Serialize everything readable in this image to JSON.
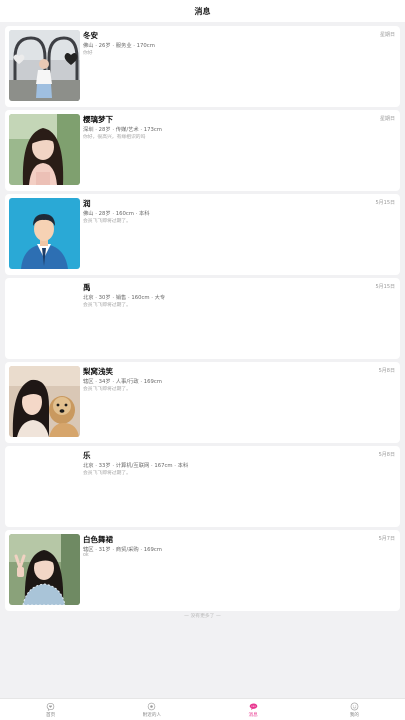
{
  "header": {
    "title": "消息"
  },
  "conversations": [
    {
      "name": "冬安",
      "date": "星期日",
      "info": "佛山 · 26岁 · 服务业 · 170cm",
      "message": "你好"
    },
    {
      "name": "樱璃梦下",
      "date": "星期日",
      "info": "深圳 · 28岁 · 传媒/艺术 · 173cm",
      "message": "你好，很高兴，有缘相识的吗"
    },
    {
      "name": "润",
      "date": "5月15日",
      "info": "佛山 · 28岁 · 160cm · 本科",
      "message": "会员飞飞即将过期了。"
    },
    {
      "name": "禹",
      "date": "5月15日",
      "info": "北京 · 30岁 · 销售 · 160cm · 大专",
      "message": "会员飞飞即将过期了。"
    },
    {
      "name": "梨窝浅笑",
      "date": "5月8日",
      "info": "辖区 · 34岁 · 人事/行政 · 169cm",
      "message": "会员飞飞即将过期了。"
    },
    {
      "name": "乐",
      "date": "5月8日",
      "info": "北京 · 33岁 · 计算机/互联网 · 167cm · 本科",
      "message": "会员飞飞即将过期了。"
    },
    {
      "name": "白色舞裙",
      "date": "5月7日",
      "info": "辖区 · 31岁 · 商贸/采购 · 169cm",
      "message": "ok"
    }
  ],
  "end_note": "— 没有更多了 —",
  "tabbar": {
    "tabs": [
      {
        "label": "首页",
        "icon": "home-heart-icon"
      },
      {
        "label": "附近的人",
        "icon": "nearby-icon"
      },
      {
        "label": "消息",
        "icon": "message-icon"
      },
      {
        "label": "我的",
        "icon": "profile-icon"
      }
    ],
    "active": "消息"
  },
  "colors": {
    "accent": "#e8368f",
    "background": "#f1f1f3"
  }
}
